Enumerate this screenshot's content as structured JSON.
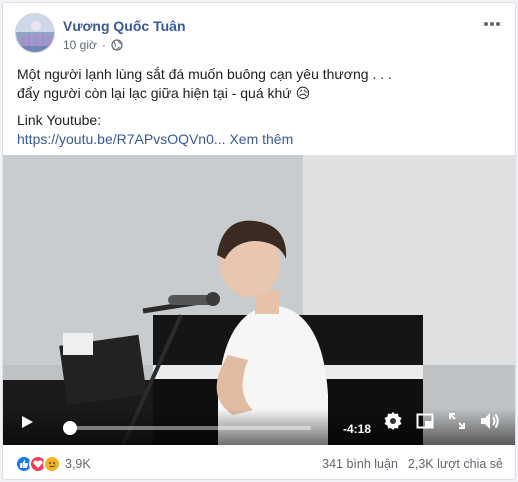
{
  "post": {
    "author": "Vương Quốc Tuân",
    "time": "10 giờ",
    "text_line1": "Một người lạnh lùng sắt đá muốn buông cạn yêu thương . . .",
    "text_line2": "đẩy người còn lại lạc giữa hiện tại - quá khứ",
    "text_emoji": "😥",
    "link_label": "Link Youtube:",
    "link_url": "https://youtu.be/R7APvsOQVn0...",
    "see_more": "Xem thêm"
  },
  "video": {
    "remaining_time": "-4:18",
    "progress": 0.02
  },
  "footer": {
    "reaction_count": "3,9K",
    "comments": "341 bình luận",
    "shares": "2,3K lượt chia sẻ"
  },
  "icons": {
    "like": "thumbs-up-icon",
    "love": "heart-icon",
    "sad": "sad-face-icon",
    "privacy": "globe-icon",
    "more": "more-dots-icon"
  },
  "colors": {
    "author": "#385898",
    "like": "#1877f2",
    "love": "#f33e58",
    "sad": "#f7b125"
  }
}
